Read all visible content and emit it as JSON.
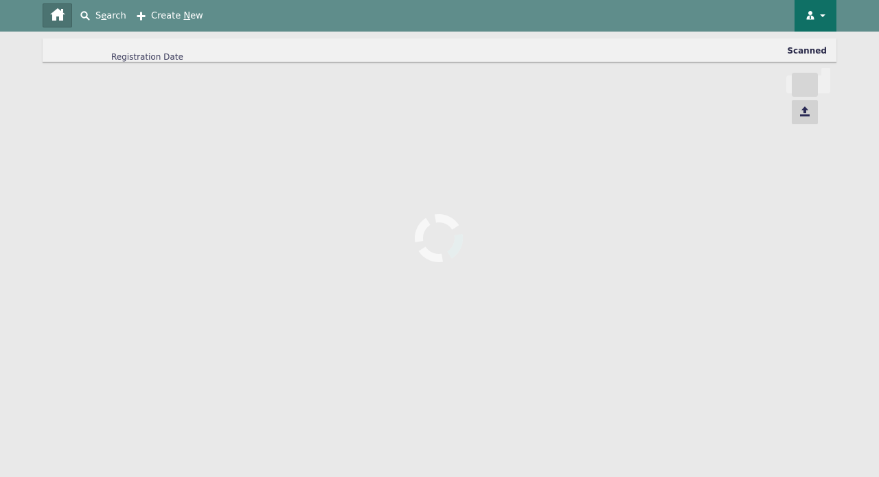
{
  "navbar": {
    "home_icon": "home-icon",
    "search": {
      "label_pre": "S",
      "label_ul": "e",
      "label_post": "arch",
      "icon": "search-icon"
    },
    "create_new": {
      "label_pre": "Create ",
      "label_ul": "N",
      "label_post": "ew",
      "icon": "plus-icon"
    },
    "user_menu": {
      "icon": "user-icon",
      "caret": "caret-down-icon"
    }
  },
  "header_panel": {
    "registration_date_label": "Registration Date",
    "scanned_label": "Scanned"
  },
  "actions": {
    "upload_icon": "upload-icon"
  },
  "loading": {
    "spinner_icon": "loading-spinner-icon"
  },
  "colors": {
    "navbar": "#5f8d8b",
    "home_button": "#4b7371",
    "user_button": "#0f7065",
    "background": "#e9e9e9",
    "panel": "#f1f1f1",
    "text_dark": "#2b2b4a"
  }
}
